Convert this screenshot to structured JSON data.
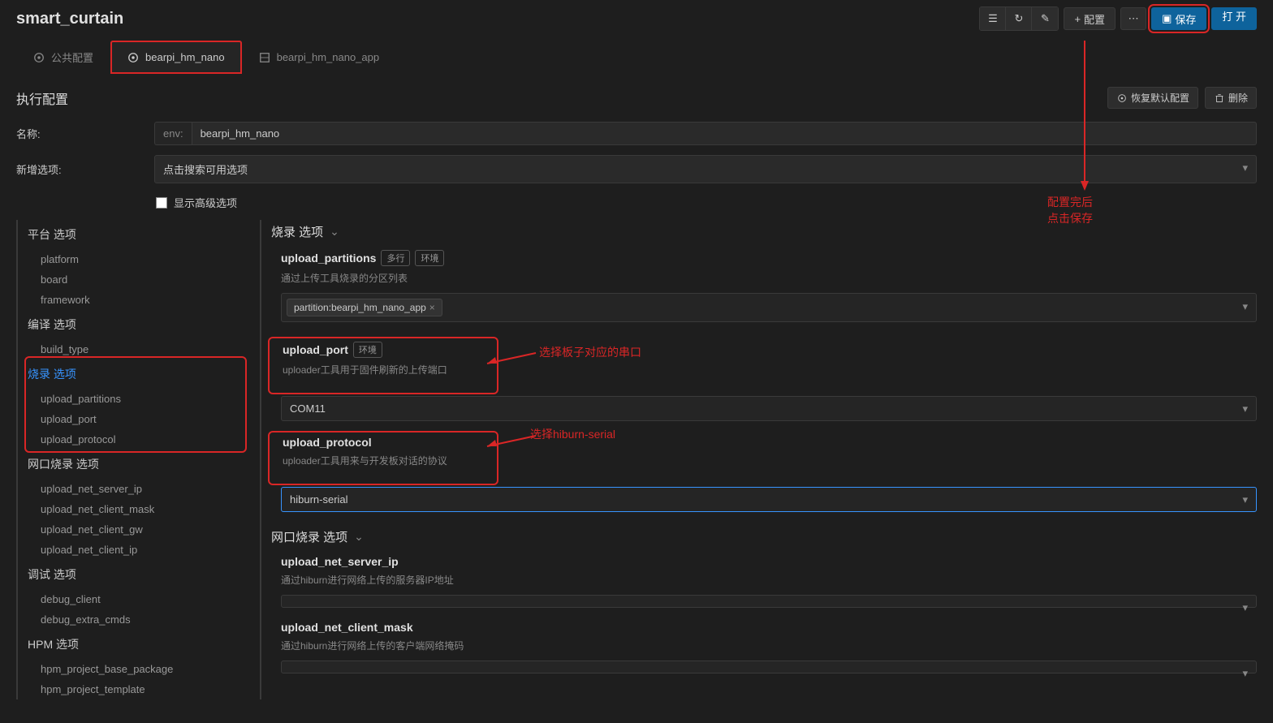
{
  "header": {
    "title": "smart_curtain",
    "configBtn": "配置",
    "saveBtn": "保存",
    "openBtn": "打 开"
  },
  "tabs": [
    {
      "icon": "target",
      "label": "公共配置",
      "active": false
    },
    {
      "icon": "target",
      "label": "bearpi_hm_nano",
      "active": true,
      "highlight": true
    },
    {
      "icon": "partition",
      "label": "bearpi_hm_nano_app",
      "active": false
    }
  ],
  "section": {
    "title": "执行配置",
    "restoreBtn": "恢复默认配置",
    "deleteBtn": "删除"
  },
  "form": {
    "nameLabel": "名称:",
    "namePrefix": "env:",
    "nameValue": "bearpi_hm_nano",
    "newOptionLabel": "新增选项:",
    "searchPlaceholder": "点击搜索可用选项",
    "showAdvanced": "显示高级选项"
  },
  "sidebar": [
    {
      "title": "平台 选项",
      "items": [
        "platform",
        "board",
        "framework"
      ]
    },
    {
      "title": "编译 选项",
      "items": [
        "build_type"
      ]
    },
    {
      "title": "烧录 选项",
      "active": true,
      "highlight": true,
      "items": [
        "upload_partitions",
        "upload_port",
        "upload_protocol"
      ]
    },
    {
      "title": "网口烧录 选项",
      "items": [
        "upload_net_server_ip",
        "upload_net_client_mask",
        "upload_net_client_gw",
        "upload_net_client_ip"
      ]
    },
    {
      "title": "调试 选项",
      "items": [
        "debug_client",
        "debug_extra_cmds"
      ]
    },
    {
      "title": "HPM 选项",
      "items": [
        "hpm_project_base_package",
        "hpm_project_template"
      ]
    }
  ],
  "content": {
    "groupTitle": "烧录 选项",
    "options": [
      {
        "name": "upload_partitions",
        "badges": [
          "多行",
          "环境"
        ],
        "desc": "通过上传工具烧录的分区列表",
        "chips": [
          "partition:bearpi_hm_nano_app"
        ]
      },
      {
        "name": "upload_port",
        "badges": [
          "环境"
        ],
        "desc": "uploader工具用于固件刷新的上传端口",
        "value": "COM11",
        "highlight": true
      },
      {
        "name": "upload_protocol",
        "badges": [],
        "desc": "uploader工具用来与开发板对话的协议",
        "value": "hiburn-serial",
        "highlight": true,
        "focused": true
      }
    ],
    "group2Title": "网口烧录 选项",
    "options2": [
      {
        "name": "upload_net_server_ip",
        "desc": "通过hiburn进行网络上传的服务器IP地址",
        "value": ""
      },
      {
        "name": "upload_net_client_mask",
        "desc": "通过hiburn进行网络上传的客户端网络掩码",
        "value": ""
      }
    ]
  },
  "annotations": {
    "portNote": "选择板子对应的串口",
    "protocolNote": "选择hiburn-serial",
    "saveNote1": "配置完后",
    "saveNote2": "点击保存"
  }
}
